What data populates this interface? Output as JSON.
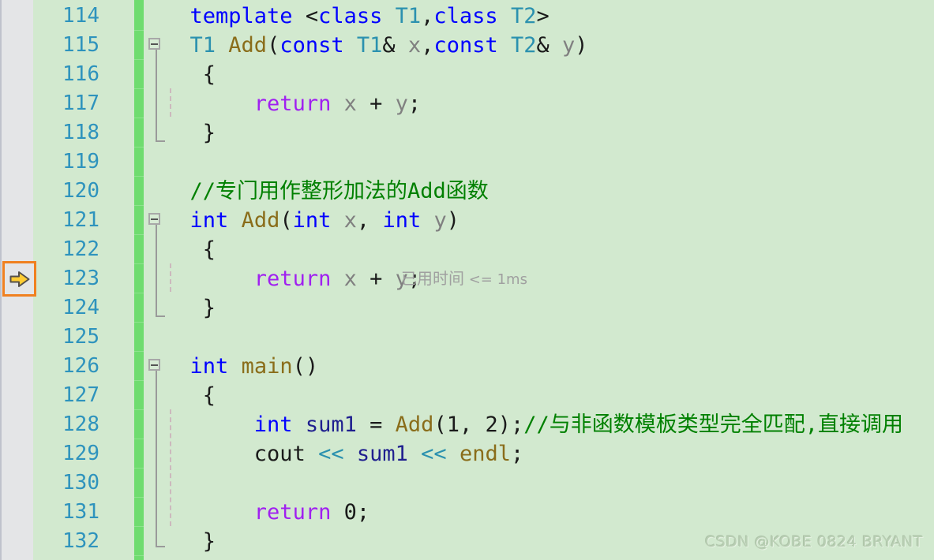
{
  "editor": {
    "app": "visual-studio-code-editor",
    "language": "C++",
    "background_color": "#d2e9cf",
    "gutter_color": "#e4e5e7",
    "change_bar_color": "#6fdc6f",
    "line_number_color": "#2e93bd",
    "first_line": 114,
    "last_line": 132,
    "line_height_px": 37
  },
  "gutter": {
    "execution_pointer": {
      "icon": "yellow-right-arrow-icon",
      "tooltip": "current-statement",
      "line": 123,
      "border_color": "#f08020",
      "arrow_color": "#ffcc33"
    }
  },
  "line_numbers": [
    "114",
    "115",
    "116",
    "117",
    "118",
    "119",
    "120",
    "121",
    "122",
    "123",
    "124",
    "125",
    "126",
    "127",
    "128",
    "129",
    "130",
    "131",
    "132"
  ],
  "code_lines": [
    {
      "number": "114",
      "tokens": [
        {
          "text": "  ",
          "cls": "t-plain"
        },
        {
          "text": "template",
          "cls": "t-kw"
        },
        {
          "text": " <",
          "cls": "t-plain"
        },
        {
          "text": "class",
          "cls": "t-kw"
        },
        {
          "text": " ",
          "cls": "t-plain"
        },
        {
          "text": "T1",
          "cls": "t-type"
        },
        {
          "text": ",",
          "cls": "t-plain"
        },
        {
          "text": "class",
          "cls": "t-kw"
        },
        {
          "text": " ",
          "cls": "t-plain"
        },
        {
          "text": "T2",
          "cls": "t-type"
        },
        {
          "text": ">",
          "cls": "t-plain"
        }
      ]
    },
    {
      "number": "115",
      "tokens": [
        {
          "text": "  ",
          "cls": "t-plain"
        },
        {
          "text": "T1",
          "cls": "t-type"
        },
        {
          "text": " ",
          "cls": "t-plain"
        },
        {
          "text": "Add",
          "cls": "t-fn"
        },
        {
          "text": "(",
          "cls": "t-plain"
        },
        {
          "text": "const",
          "cls": "t-kw"
        },
        {
          "text": " ",
          "cls": "t-plain"
        },
        {
          "text": "T1",
          "cls": "t-type"
        },
        {
          "text": "& ",
          "cls": "t-plain"
        },
        {
          "text": "x",
          "cls": "t-var"
        },
        {
          "text": ",",
          "cls": "t-plain"
        },
        {
          "text": "const",
          "cls": "t-kw"
        },
        {
          "text": " ",
          "cls": "t-plain"
        },
        {
          "text": "T2",
          "cls": "t-type"
        },
        {
          "text": "& ",
          "cls": "t-plain"
        },
        {
          "text": "y",
          "cls": "t-var"
        },
        {
          "text": ")",
          "cls": "t-plain"
        }
      ]
    },
    {
      "number": "116",
      "tokens": [
        {
          "text": "   {",
          "cls": "t-plain"
        }
      ]
    },
    {
      "number": "117",
      "tokens": [
        {
          "text": "       ",
          "cls": "t-plain"
        },
        {
          "text": "return",
          "cls": "t-ctrl"
        },
        {
          "text": " ",
          "cls": "t-plain"
        },
        {
          "text": "x",
          "cls": "t-var"
        },
        {
          "text": " + ",
          "cls": "t-plain"
        },
        {
          "text": "y",
          "cls": "t-var"
        },
        {
          "text": ";",
          "cls": "t-plain"
        }
      ]
    },
    {
      "number": "118",
      "tokens": [
        {
          "text": "   }",
          "cls": "t-plain"
        }
      ]
    },
    {
      "number": "119",
      "tokens": []
    },
    {
      "number": "120",
      "tokens": [
        {
          "text": "  ",
          "cls": "t-plain"
        },
        {
          "text": "//专门用作整形加法的Add函数",
          "cls": "t-comment"
        }
      ]
    },
    {
      "number": "121",
      "tokens": [
        {
          "text": "  ",
          "cls": "t-plain"
        },
        {
          "text": "int",
          "cls": "t-kw"
        },
        {
          "text": " ",
          "cls": "t-plain"
        },
        {
          "text": "Add",
          "cls": "t-fn"
        },
        {
          "text": "(",
          "cls": "t-plain"
        },
        {
          "text": "int",
          "cls": "t-kw"
        },
        {
          "text": " ",
          "cls": "t-plain"
        },
        {
          "text": "x",
          "cls": "t-var"
        },
        {
          "text": ", ",
          "cls": "t-plain"
        },
        {
          "text": "int",
          "cls": "t-kw"
        },
        {
          "text": " ",
          "cls": "t-plain"
        },
        {
          "text": "y",
          "cls": "t-var"
        },
        {
          "text": ")",
          "cls": "t-plain"
        }
      ]
    },
    {
      "number": "122",
      "tokens": [
        {
          "text": "   {",
          "cls": "t-plain"
        }
      ]
    },
    {
      "number": "123",
      "tokens": [
        {
          "text": "       ",
          "cls": "t-plain"
        },
        {
          "text": "return",
          "cls": "t-ctrl"
        },
        {
          "text": " ",
          "cls": "t-plain"
        },
        {
          "text": "x",
          "cls": "t-var"
        },
        {
          "text": " + ",
          "cls": "t-plain"
        },
        {
          "text": "y",
          "cls": "t-var"
        },
        {
          "text": ";",
          "cls": "t-plain"
        }
      ]
    },
    {
      "number": "124",
      "tokens": [
        {
          "text": "   }",
          "cls": "t-plain"
        }
      ]
    },
    {
      "number": "125",
      "tokens": []
    },
    {
      "number": "126",
      "tokens": [
        {
          "text": "  ",
          "cls": "t-plain"
        },
        {
          "text": "int",
          "cls": "t-kw"
        },
        {
          "text": " ",
          "cls": "t-plain"
        },
        {
          "text": "main",
          "cls": "t-fn"
        },
        {
          "text": "()",
          "cls": "t-plain"
        }
      ]
    },
    {
      "number": "127",
      "tokens": [
        {
          "text": "   {",
          "cls": "t-plain"
        }
      ]
    },
    {
      "number": "128",
      "tokens": [
        {
          "text": "       ",
          "cls": "t-plain"
        },
        {
          "text": "int",
          "cls": "t-kw"
        },
        {
          "text": " ",
          "cls": "t-plain"
        },
        {
          "text": "sum1",
          "cls": "t-ident"
        },
        {
          "text": " = ",
          "cls": "t-plain"
        },
        {
          "text": "Add",
          "cls": "t-fn"
        },
        {
          "text": "(",
          "cls": "t-plain"
        },
        {
          "text": "1",
          "cls": "t-num"
        },
        {
          "text": ", ",
          "cls": "t-plain"
        },
        {
          "text": "2",
          "cls": "t-num"
        },
        {
          "text": ");",
          "cls": "t-plain"
        },
        {
          "text": "//与非函数模板类型完全匹配,直接调用",
          "cls": "t-comment"
        }
      ]
    },
    {
      "number": "129",
      "tokens": [
        {
          "text": "       ",
          "cls": "t-plain"
        },
        {
          "text": "cout",
          "cls": "t-plain"
        },
        {
          "text": " ",
          "cls": "t-plain"
        },
        {
          "text": "<<",
          "cls": "t-stream"
        },
        {
          "text": " ",
          "cls": "t-plain"
        },
        {
          "text": "sum1",
          "cls": "t-ident"
        },
        {
          "text": " ",
          "cls": "t-plain"
        },
        {
          "text": "<<",
          "cls": "t-stream"
        },
        {
          "text": " ",
          "cls": "t-plain"
        },
        {
          "text": "endl",
          "cls": "t-fn"
        },
        {
          "text": ";",
          "cls": "t-plain"
        }
      ]
    },
    {
      "number": "130",
      "tokens": []
    },
    {
      "number": "131",
      "tokens": [
        {
          "text": "       ",
          "cls": "t-plain"
        },
        {
          "text": "return",
          "cls": "t-ctrl"
        },
        {
          "text": " ",
          "cls": "t-plain"
        },
        {
          "text": "0",
          "cls": "t-num"
        },
        {
          "text": ";",
          "cls": "t-plain"
        }
      ]
    },
    {
      "number": "132",
      "tokens": [
        {
          "text": "   }",
          "cls": "t-plain"
        }
      ]
    }
  ],
  "inline_hints": [
    {
      "line": "123",
      "cn_text": "已用时间",
      "en_text": " <= 1ms",
      "color": "#a0a0a0"
    }
  ],
  "outlining": [
    {
      "line": "115",
      "state": "expanded",
      "icon": "collapse-minus-icon"
    },
    {
      "line": "121",
      "state": "expanded",
      "icon": "collapse-minus-icon"
    },
    {
      "line": "126",
      "state": "expanded",
      "icon": "collapse-minus-icon"
    }
  ],
  "watermark": {
    "text": "CSDN @KOBE 0824 BRYANT"
  }
}
